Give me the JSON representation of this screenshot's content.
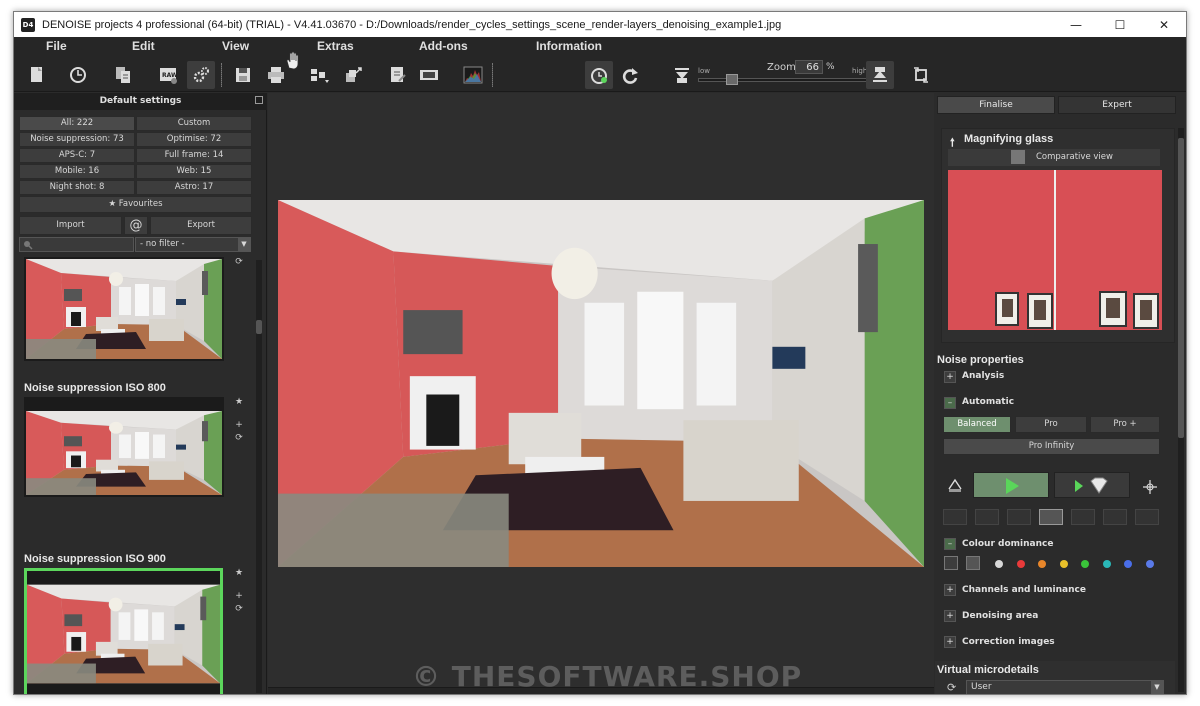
{
  "window": {
    "title": "DENOISE projects 4 professional (64-bit) (TRIAL) - V4.41.03670 - D:/Downloads/render_cycles_settings_scene_render-layers_denoising_example1.jpg",
    "logo": "D4",
    "minimize": "—",
    "maximize": "☐",
    "close": "✕"
  },
  "menu": [
    "File",
    "Edit",
    "View",
    "Extras",
    "Add-ons",
    "Information"
  ],
  "toolbar": {
    "icons": [
      "new-file-icon",
      "history-icon",
      "copy-icon",
      "raw-icon",
      "batch-settings-icon",
      "save-icon",
      "print-icon",
      "export-icon",
      "share-icon",
      "edit-icon",
      "compare-icon",
      "histogram-icon",
      "hand-icon",
      "timer-icon",
      "redo-icon",
      "zoom-out-icon",
      "zoom-in-icon",
      "rotate-icon"
    ],
    "zoom_label": "Zoom",
    "zoom_value": "66",
    "zoom_unit": "%",
    "zoom_low": "low",
    "zoom_high": "high",
    "zoom_level_fraction": 0.05
  },
  "left_panel": {
    "header": "Default settings",
    "filters": [
      {
        "label": "All: 222"
      },
      {
        "label": "Custom"
      },
      {
        "label": "Noise suppression: 73"
      },
      {
        "label": "Optimise: 72"
      },
      {
        "label": "APS-C: 7"
      },
      {
        "label": "Full frame: 14"
      },
      {
        "label": "Mobile: 16"
      },
      {
        "label": "Web: 15"
      },
      {
        "label": "Night shot: 8"
      },
      {
        "label": "Astro: 17"
      }
    ],
    "favourites": "Favourites",
    "import": "Import",
    "at_symbol": "@",
    "export": "Export",
    "filter_select": "- no filter -",
    "presets": [
      {
        "title": ""
      },
      {
        "title": "Noise suppression ISO 800"
      },
      {
        "title": "Noise suppression ISO 900"
      }
    ]
  },
  "right_panel": {
    "tabs": [
      "Finalise",
      "Expert"
    ],
    "magnifier_title": "Magnifying glass",
    "comparative_view": "Comparative view",
    "noise_properties": "Noise properties",
    "analysis": "Analysis",
    "automatic": "Automatic",
    "modes": [
      "Balanced",
      "Pro",
      "Pro +"
    ],
    "pro_infinity": "Pro Infinity",
    "colour_dominance": "Colour dominance",
    "dominance_colors": [
      "#d8d8d8",
      "#e83a3a",
      "#e8862a",
      "#e8c02a",
      "#3ac43a",
      "#2ab8b8",
      "#4a6ee8",
      "#5a7ae8"
    ],
    "channels": "Channels and luminance",
    "denoising_area": "Denoising area",
    "correction_images": "Correction images",
    "virtual_microdetails": "Virtual microdetails",
    "user_select": "User"
  },
  "watermark": "© THESOFTWARE.SHOP"
}
